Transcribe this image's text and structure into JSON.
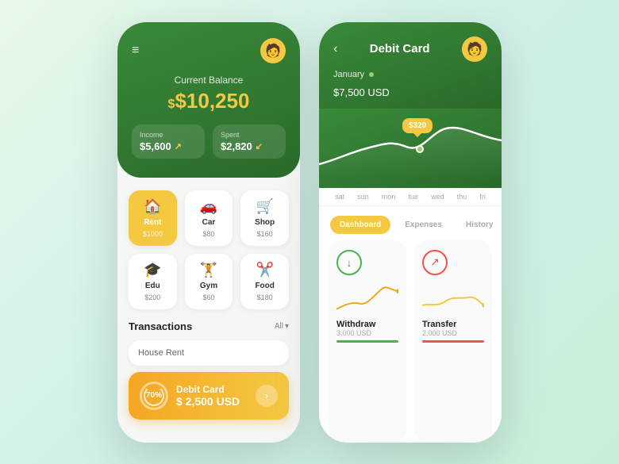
{
  "left_phone": {
    "header": {
      "balance_label": "Current Balance",
      "balance_amount": "$10,250",
      "income_label": "Income",
      "income_value": "$5,600",
      "spent_label": "Spent",
      "spent_value": "$2,820"
    },
    "categories": [
      {
        "name": "Rent",
        "amount": "$1000",
        "icon": "🏠",
        "active": true
      },
      {
        "name": "Car",
        "amount": "$80",
        "icon": "🚗",
        "active": false
      },
      {
        "name": "Shop",
        "amount": "$160",
        "icon": "🛒",
        "active": false
      },
      {
        "name": "Edu",
        "amount": "$200",
        "icon": "🎓",
        "active": false
      },
      {
        "name": "Gym",
        "amount": "$60",
        "icon": "🏋️",
        "active": false
      },
      {
        "name": "Food",
        "amount": "$180",
        "icon": "✂️",
        "active": false
      }
    ],
    "transactions": {
      "title": "Transactions",
      "filter": "All",
      "items": [
        {
          "name": "House Rent",
          "type": "text"
        },
        {
          "name": "Debit Card",
          "amount": "$ 2,500 USD",
          "percentage": "70%",
          "type": "debit"
        }
      ]
    }
  },
  "right_phone": {
    "header": {
      "title": "Debit Card",
      "month": "January",
      "balance": "$7,500 USD",
      "tooltip_amount": "$320"
    },
    "chart_days": [
      "sat",
      "sun",
      "mon",
      "tue",
      "wed",
      "thu",
      "fri"
    ],
    "tabs": [
      {
        "label": "Dashboard",
        "active": true
      },
      {
        "label": "Expenses",
        "active": false
      },
      {
        "label": "History",
        "active": false
      }
    ],
    "cards": [
      {
        "label": "Withdraw",
        "amount": "3,000 USD",
        "bar_color": "green",
        "icon_type": "green"
      },
      {
        "label": "Transfer",
        "amount": "2,000 USD",
        "bar_color": "red",
        "icon_type": "red"
      }
    ]
  }
}
